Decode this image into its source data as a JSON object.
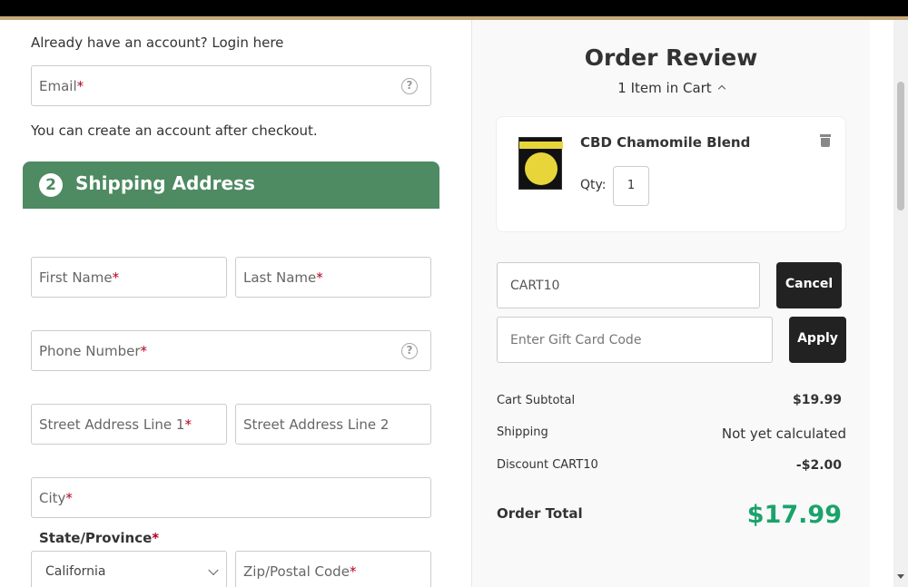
{
  "checkout": {
    "login_prompt": "Already have an account? Login here",
    "email": {
      "label": "Email",
      "required": "*"
    },
    "create_note": "You can create an account after checkout.",
    "shipping": {
      "step_number": "2",
      "title": "Shipping Address",
      "first_name": {
        "label": "First Name",
        "required": "*"
      },
      "last_name": {
        "label": "Last Name",
        "required": "*"
      },
      "phone": {
        "label": "Phone Number",
        "required": "*"
      },
      "street1": {
        "label": "Street Address Line 1",
        "required": "*"
      },
      "street2": {
        "label": "Street Address Line 2"
      },
      "city": {
        "label": "City",
        "required": "*"
      },
      "state": {
        "label": "State/Province",
        "required": "*",
        "selected": "California"
      },
      "zip": {
        "label": "Zip/Postal Code",
        "required": "*"
      }
    },
    "help_glyph": "?"
  },
  "order_review": {
    "title": "Order Review",
    "cart_count": "1 Item in Cart",
    "item": {
      "name": "CBD Chamomile Blend",
      "qty_label": "Qty:",
      "qty": "1"
    },
    "coupon": {
      "value": "CART10",
      "button": "Cancel"
    },
    "gift_card": {
      "placeholder": "Enter Gift Card Code",
      "button": "Apply"
    },
    "summary": {
      "subtotal_label": "Cart Subtotal",
      "subtotal": "$19.99",
      "shipping_label": "Shipping",
      "shipping": "Not yet calculated",
      "discount_label": "Discount CART10",
      "discount": "-$2.00",
      "total_label": "Order Total",
      "total": "$17.99"
    }
  },
  "colors": {
    "header_green": "#4e8a62",
    "total_green": "#1aa36b",
    "accent_gold": "#c6a97a",
    "button_dark": "#222222"
  }
}
